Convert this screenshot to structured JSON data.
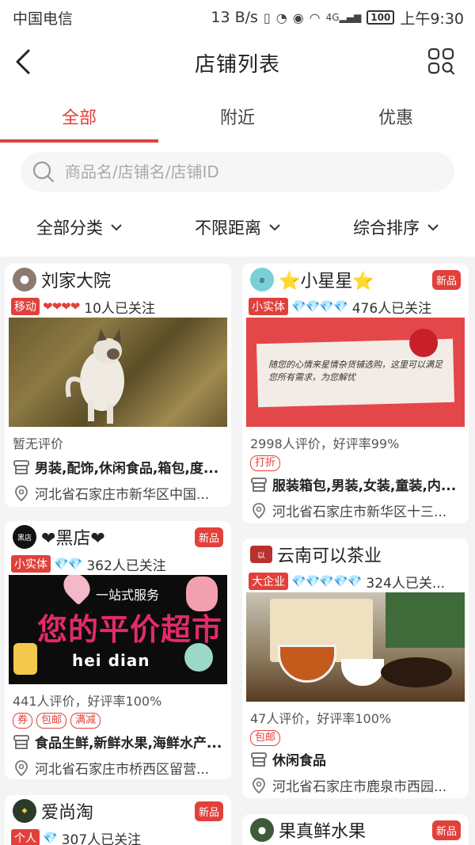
{
  "status_bar": {
    "carrier": "中国电信",
    "speed": "13 B/s",
    "network": "4G",
    "battery": "100",
    "time": "上午9:30"
  },
  "header": {
    "title": "店铺列表",
    "back_icon": "chevron-left-icon",
    "qr_icon": "scan-icon"
  },
  "tabs": [
    {
      "label": "全部",
      "active": true
    },
    {
      "label": "附近",
      "active": false
    },
    {
      "label": "优惠",
      "active": false
    }
  ],
  "search": {
    "placeholder": "商品名/店铺名/店铺ID",
    "value": ""
  },
  "filters": [
    {
      "label": "全部分类"
    },
    {
      "label": "不限距离"
    },
    {
      "label": "综合排序"
    }
  ],
  "shops": [
    {
      "name": "刘家大院",
      "badge": "",
      "type": "移动",
      "level": "❤❤❤❤",
      "followers": "10人已关注",
      "rating": "暂无评价",
      "promos": [],
      "categories": "男装,配饰,休闲食品,箱包,度...",
      "address": "河北省石家庄市新华区中国...",
      "image_desc": "cat"
    },
    {
      "name": "⭐小星星⭐",
      "badge": "新品",
      "type": "小实体",
      "level": "💎💎💎💎",
      "followers": "476人已关注",
      "rating": "2998人评价，好评率99%",
      "promos": [
        "打折"
      ],
      "categories": "服装箱包,男装,女装,童装,内...",
      "address": "河北省石家庄市新华区十三...",
      "image_text": "随您的心情来星情杂货铺选购，这里可以满足您所有需求，为您解忧"
    },
    {
      "name": "❤黑店❤",
      "badge": "新品",
      "type": "小实体",
      "level": "💎💎",
      "followers": "362人已关注",
      "rating": "441人评价，好评率100%",
      "promos": [
        "券",
        "包邮",
        "满减"
      ],
      "categories": "食品生鲜,新鲜水果,海鲜水产...",
      "address": "河北省石家庄市桥西区留营...",
      "image_title": "一站式服务",
      "image_main": "您的平价超市",
      "image_sub": "hei dian",
      "avatar_text": "黑店"
    },
    {
      "name": "云南可以茶业",
      "badge": "",
      "type": "大企业",
      "level": "💎💎💎💎💎",
      "followers": "324人已关...",
      "rating": "47人评价，好评率100%",
      "promos": [
        "包邮"
      ],
      "categories": "休闲食品",
      "address": "河北省石家庄市鹿泉市西园..."
    },
    {
      "name": "爱尚淘",
      "badge": "新品",
      "type": "个人",
      "level": "💎",
      "followers": "307人已关注"
    },
    {
      "name": "果真鲜水果",
      "badge": "新品"
    }
  ],
  "colors": {
    "accent": "#e0413c",
    "tag_bg": "#e2403b"
  }
}
